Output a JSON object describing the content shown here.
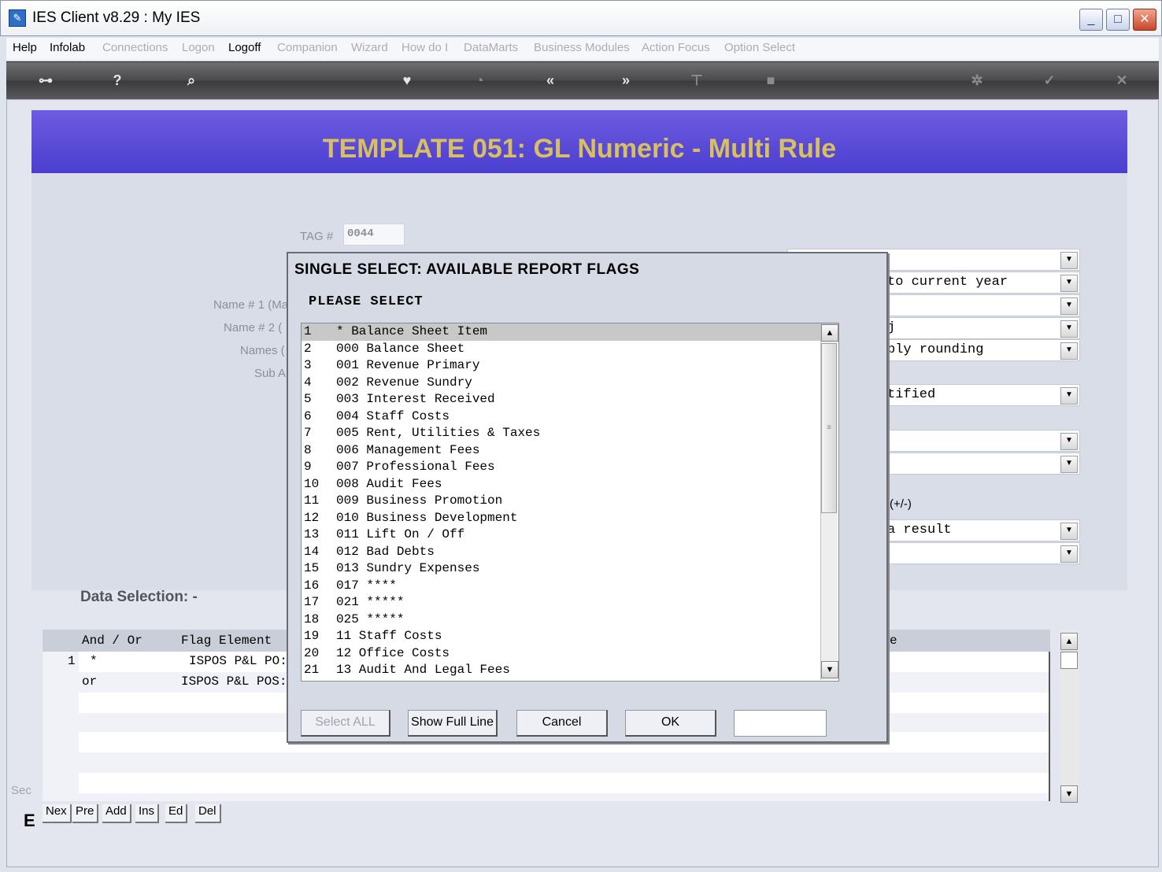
{
  "window": {
    "title": "IES Client v8.29 : My IES"
  },
  "menu": [
    {
      "label": "Help",
      "enabled": true
    },
    {
      "label": "Infolab",
      "enabled": true
    },
    {
      "label": "Connections",
      "enabled": false
    },
    {
      "label": "Logon",
      "enabled": false
    },
    {
      "label": "Logoff",
      "enabled": true
    },
    {
      "label": "Companion",
      "enabled": false
    },
    {
      "label": "Wizard",
      "enabled": false
    },
    {
      "label": "How do I",
      "enabled": false
    },
    {
      "label": "DataMarts",
      "enabled": false
    },
    {
      "label": "Business Modules",
      "enabled": false
    },
    {
      "label": "Action Focus",
      "enabled": false
    },
    {
      "label": "Option Select",
      "enabled": false
    }
  ],
  "toolbar": {
    "icons": [
      "key-icon",
      "help-icon",
      "search-icon",
      "heart-icon",
      "clock-icon",
      "prev-icon",
      "next-icon",
      "tree-icon",
      "stop-icon",
      "gear-icon",
      "check-icon",
      "close-icon"
    ]
  },
  "banner": {
    "title": "TEMPLATE 051: GL Numeric   - Multi Rule"
  },
  "form": {
    "tag_label": "TAG #",
    "tag_value": "0044",
    "name1_label": "Name # 1 (Ma",
    "name2_label": "Name # 2 (",
    "names_label": "Names (",
    "sub_label": "Sub A",
    "combos": [
      "",
      "to current year",
      "",
      "j",
      "ply rounding",
      "tified",
      "",
      ""
    ],
    "sign_label": "(+/-)",
    "combos2": [
      "a result",
      ""
    ]
  },
  "data_selection": {
    "title": "Data Selection: -",
    "headers": [
      "And / Or",
      "Flag Element",
      "e"
    ],
    "rows": [
      {
        "num": "1",
        "andor": "*",
        "flag": "ISPOS P&L PO:"
      },
      {
        "num": "",
        "andor": "or",
        "flag": "ISPOS P&L POS:"
      }
    ],
    "nav": [
      "Nex",
      "Pre",
      "Add",
      "Ins",
      "Ed",
      "Del"
    ],
    "sec_label": "Sec",
    "e_label": "E"
  },
  "dialog": {
    "title": "SINGLE SELECT: AVAILABLE REPORT FLAGS",
    "prompt": "PLEASE SELECT",
    "items": [
      {
        "n": "1",
        "t": "* Balance Sheet Item"
      },
      {
        "n": "2",
        "t": "000 Balance Sheet"
      },
      {
        "n": "3",
        "t": "001 Revenue Primary"
      },
      {
        "n": "4",
        "t": "002 Revenue Sundry"
      },
      {
        "n": "5",
        "t": "003 Interest Received"
      },
      {
        "n": "6",
        "t": "004 Staff Costs"
      },
      {
        "n": "7",
        "t": "005 Rent, Utilities & Taxes"
      },
      {
        "n": "8",
        "t": "006 Management Fees"
      },
      {
        "n": "9",
        "t": "007 Professional Fees"
      },
      {
        "n": "10",
        "t": "008 Audit Fees"
      },
      {
        "n": "11",
        "t": "009 Business Promotion"
      },
      {
        "n": "12",
        "t": "010 Business Development"
      },
      {
        "n": "13",
        "t": "011 Lift On / Off"
      },
      {
        "n": "14",
        "t": "012 Bad Debts"
      },
      {
        "n": "15",
        "t": "013 Sundry Expenses"
      },
      {
        "n": "16",
        "t": "017 ****"
      },
      {
        "n": "17",
        "t": "021 *****"
      },
      {
        "n": "18",
        "t": "025 *****"
      },
      {
        "n": "19",
        "t": "11 Staff Costs"
      },
      {
        "n": "20",
        "t": "12 Office Costs"
      },
      {
        "n": "21",
        "t": "13 Audit And Legal Fees"
      }
    ],
    "selected_index": 0,
    "buttons": {
      "select_all": "Select ALL",
      "show_full_line": "Show Full Line",
      "cancel": "Cancel",
      "ok": "OK"
    },
    "filter_value": ""
  }
}
